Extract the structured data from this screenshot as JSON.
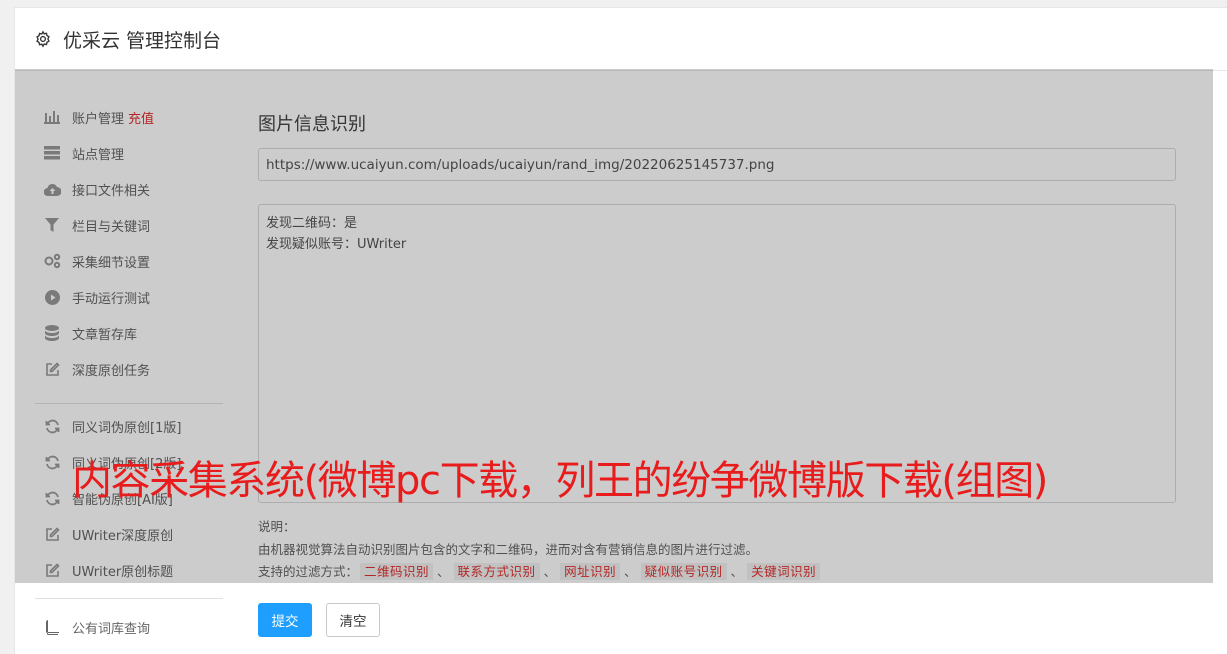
{
  "header": {
    "title": "优采云 管理控制台",
    "icon": "gear-icon"
  },
  "sidebar": {
    "items": [
      {
        "label": "账户管理",
        "badge": "充值",
        "icon": "bar-chart-icon"
      },
      {
        "label": "站点管理",
        "icon": "server-icon"
      },
      {
        "label": "接口文件相关",
        "icon": "cloud-upload-icon"
      },
      {
        "label": "栏目与关键词",
        "icon": "filter-icon"
      },
      {
        "label": "采集细节设置",
        "icon": "cogs-icon"
      },
      {
        "label": "手动运行测试",
        "icon": "play-circle-icon"
      },
      {
        "label": "文章暂存库",
        "icon": "database-icon"
      },
      {
        "label": "深度原创任务",
        "icon": "edit-icon"
      },
      {
        "label": "同义词伪原创[1版]",
        "icon": "refresh-icon"
      },
      {
        "label": "同义词伪原创[2版]",
        "icon": "refresh-icon"
      },
      {
        "label": "智能伪原创[AI版]",
        "icon": "refresh-icon"
      },
      {
        "label": "UWriter深度原创",
        "icon": "edit-icon"
      },
      {
        "label": "UWriter原创标题",
        "icon": "edit-icon"
      },
      {
        "label": "公有词库查询",
        "icon": "book-icon"
      }
    ]
  },
  "main": {
    "title": "图片信息识别",
    "url_value": "https://www.ucaiyun.com/uploads/ucaiyun/rand_img/20220625145737.png",
    "result_lines": [
      "发现二维码：是",
      "发现疑似账号：UWriter"
    ],
    "desc_label": "说明：",
    "desc_text": "由机器视觉算法自动识别图片包含的文字和二维码，进而对含有营销信息的图片进行过滤。",
    "filter_label": "支持的过滤方式：",
    "filters": [
      "二维码识别",
      "联系方式识别",
      "网址识别",
      "疑似账号识别",
      "关键词识别"
    ],
    "filter_separator": "、",
    "submit_label": "提交",
    "clear_label": "清空"
  },
  "overlay": {
    "caption": "内容采集系统(微博pc下载，列王的纷争微博版下载(组图)",
    "caption_color": "#e81c1c"
  },
  "colors": {
    "accent": "#1e9fff",
    "danger": "#e0302e"
  }
}
